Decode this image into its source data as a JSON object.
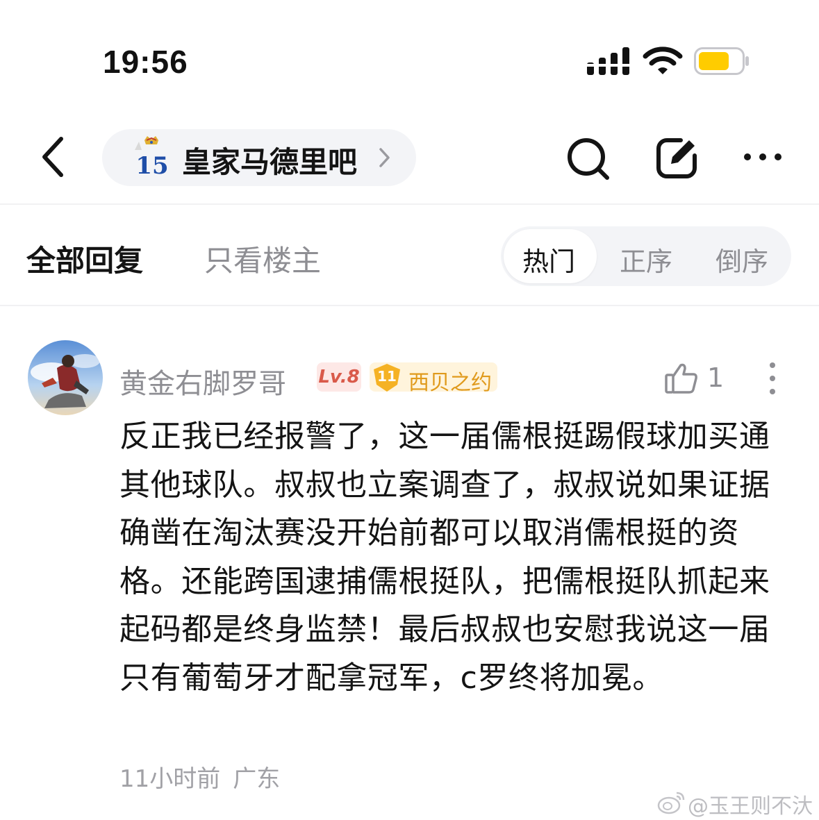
{
  "status_bar": {
    "time": "19:56",
    "battery_color": "#ffcc00"
  },
  "nav": {
    "forum_name": "皇家马德里吧",
    "forum_logo_number": "15",
    "icons": [
      "back-icon",
      "chevron-right-icon",
      "search-icon",
      "edit-icon",
      "more-icon"
    ]
  },
  "filters": {
    "all_replies": "全部回复",
    "op_only": "只看楼主",
    "sort": {
      "hot": "热门",
      "ascending": "正序",
      "descending": "倒序",
      "selected": "热门"
    }
  },
  "comment": {
    "username": "黄金右脚罗哥",
    "level": "Lv.8",
    "fan_level": "11",
    "fan_title": "西贝之约",
    "likes": "1",
    "text": "反正我已经报警了，这一届儒根挺踢假球加买通其他球队。叔叔也立案调查了，叔叔说如果证据确凿在淘汰赛没开始前都可以取消儒根挺的资格。还能跨国逮捕儒根挺队，把儒根挺队抓起来起码都是终身监禁！最后叔叔也安慰我说这一届只有葡萄牙才配拿冠军，c罗终将加冕。",
    "time_ago": "11小时前",
    "location": "广东"
  },
  "watermark": {
    "text": "@玉王则不汏"
  }
}
